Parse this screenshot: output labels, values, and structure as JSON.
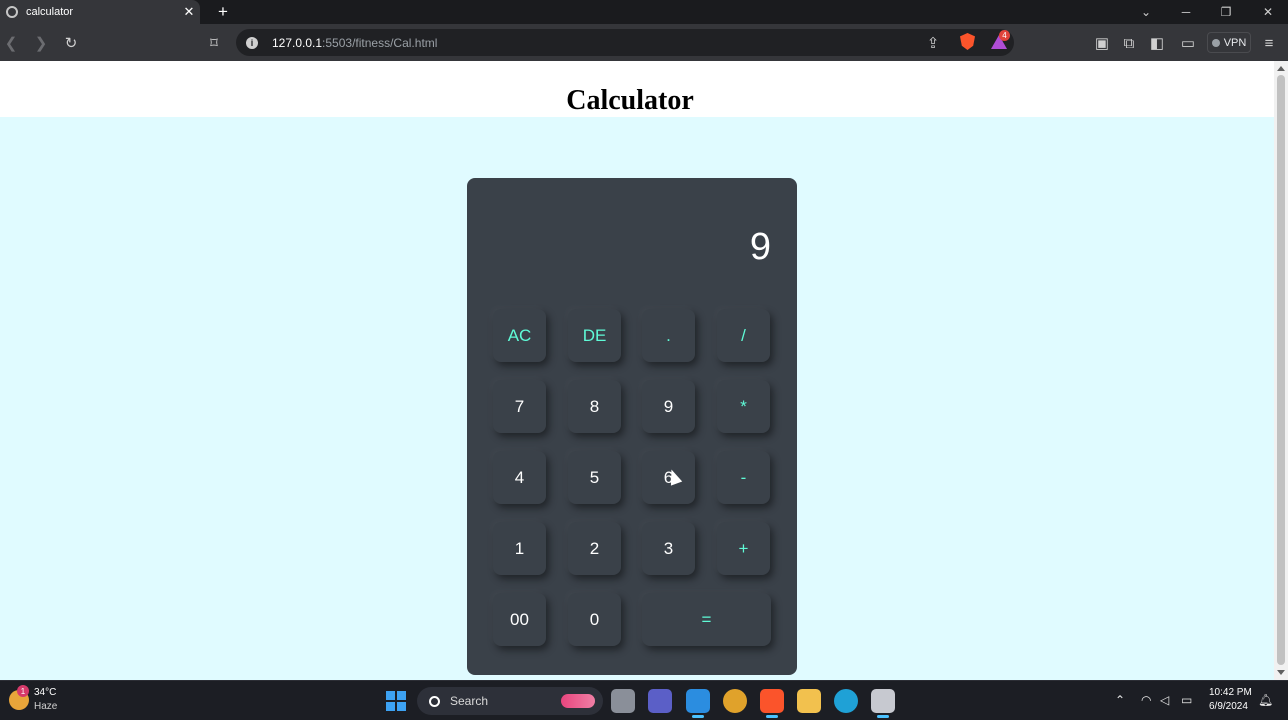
{
  "browser": {
    "tab_title": "calculator",
    "tab_close": "✕",
    "new_tab": "+",
    "url_host": "127.0.0.1",
    "url_path": ":5503/fitness/Cal.html",
    "vpn_label": "VPN",
    "rewards_count": "4"
  },
  "page": {
    "title": "Calculator"
  },
  "calculator": {
    "display": "9",
    "keys": [
      {
        "label": "AC",
        "op": true
      },
      {
        "label": "DE",
        "op": true
      },
      {
        "label": ".",
        "op": true
      },
      {
        "label": "/",
        "op": true
      },
      {
        "label": "7",
        "op": false
      },
      {
        "label": "8",
        "op": false
      },
      {
        "label": "9",
        "op": false
      },
      {
        "label": "*",
        "op": true
      },
      {
        "label": "4",
        "op": false
      },
      {
        "label": "5",
        "op": false
      },
      {
        "label": "6",
        "op": false
      },
      {
        "label": "-",
        "op": true
      },
      {
        "label": "1",
        "op": false
      },
      {
        "label": "2",
        "op": false
      },
      {
        "label": "3",
        "op": false
      },
      {
        "label": "+",
        "op": true
      },
      {
        "label": "00",
        "op": false
      },
      {
        "label": "0",
        "op": false
      },
      {
        "label": "=",
        "op": true
      }
    ]
  },
  "taskbar": {
    "weather_badge": "1",
    "weather_temp": "34°C",
    "weather_cond": "Haze",
    "search_label": "Search",
    "time": "10:42 PM",
    "date": "6/9/2024"
  },
  "colors": {
    "page_bg": "#e0fbff",
    "calc_bg": "#3a4149",
    "operator_text": "#5ffbd7",
    "digit_text": "#ffffff"
  }
}
